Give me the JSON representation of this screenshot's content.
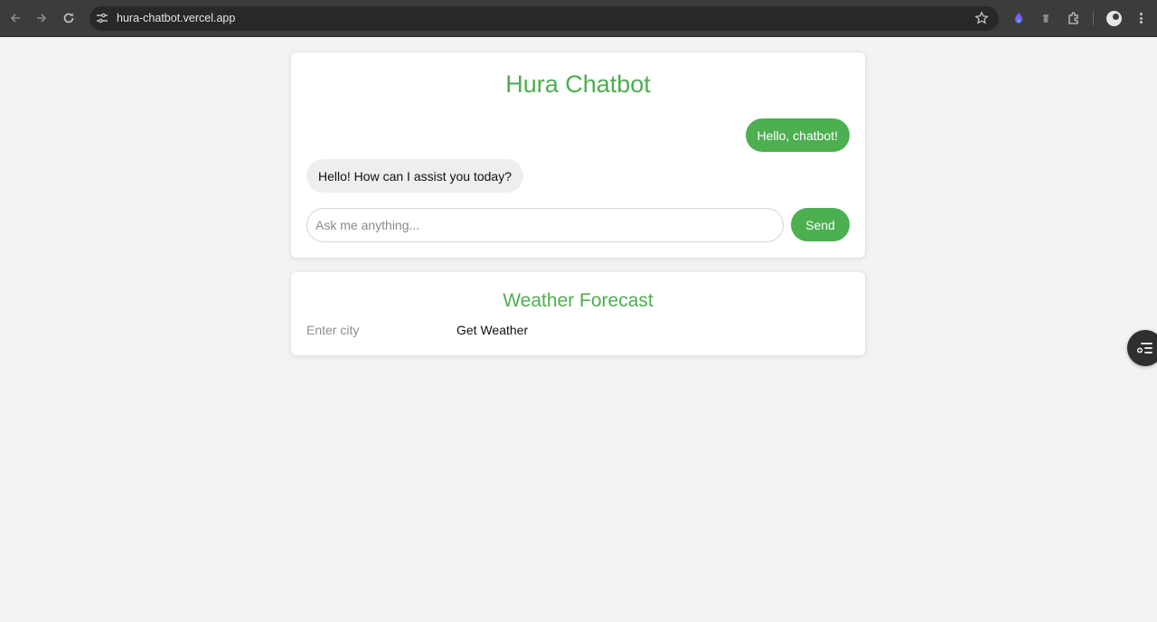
{
  "browser": {
    "url": "hura-chatbot.vercel.app",
    "icons": {
      "back": "arrow-left-icon",
      "forward": "arrow-right-icon",
      "reload": "reload-icon",
      "site_info": "tune-icon",
      "bookmark": "star-icon",
      "extensions": "puzzle-icon",
      "menu": "kebab-menu-icon"
    }
  },
  "chat": {
    "title": "Hura Chatbot",
    "messages": [
      {
        "role": "user",
        "text": "Hello, chatbot!"
      },
      {
        "role": "bot",
        "text": "Hello! How can I assist you today?"
      }
    ],
    "input_placeholder": "Ask me anything...",
    "input_value": "",
    "send_label": "Send"
  },
  "weather": {
    "title": "Weather Forecast",
    "city_placeholder": "Enter city",
    "city_value": "",
    "button_label": "Get Weather"
  },
  "colors": {
    "accent": "#4caf50",
    "page_background": "#f2f3f5",
    "browser_toolbar": "#3c3c3c"
  }
}
